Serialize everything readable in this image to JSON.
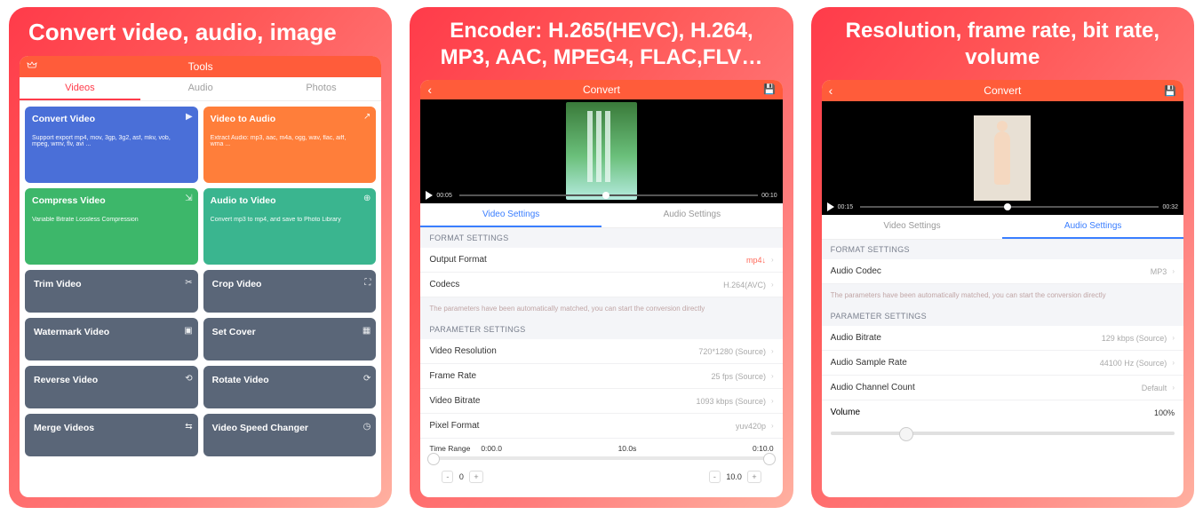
{
  "screen1": {
    "hero": "Convert video, audio, image",
    "topbar_title": "Tools",
    "tabs": [
      "Videos",
      "Audio",
      "Photos"
    ],
    "active_tab": 0,
    "cards": [
      {
        "title": "Convert Video",
        "desc": "Support export mp4, mov, 3gp, 3g2, asf, mkv, vob, mpeg, wmv, flv, avi ...",
        "icon": "play"
      },
      {
        "title": "Video to Audio",
        "desc": "Extract Audio: mp3, aac, m4a, ogg, wav, flac, aiff, wma ...",
        "icon": "export"
      },
      {
        "title": "Compress Video",
        "desc": "Variable Bitrate Lossless Compression",
        "icon": "compress"
      },
      {
        "title": "Audio to Video",
        "desc": "Convert mp3 to mp4, and save to Photo Library",
        "icon": "tovideo"
      },
      {
        "title": "Trim Video",
        "icon": "scissors"
      },
      {
        "title": "Crop Video",
        "icon": "crop"
      },
      {
        "title": "Watermark Video",
        "icon": "watermark"
      },
      {
        "title": "Set Cover",
        "icon": "cover"
      },
      {
        "title": "Reverse Video",
        "icon": "reverse"
      },
      {
        "title": "Rotate Video",
        "icon": "rotate"
      },
      {
        "title": "Merge Videos",
        "icon": "merge"
      },
      {
        "title": "Video Speed Changer",
        "icon": "speed"
      }
    ]
  },
  "screen2": {
    "hero": "Encoder: H.265(HEVC), H.264, MP3, AAC, MPEG4, FLAC,FLV…",
    "nav_title": "Convert",
    "time_left": "00:05",
    "time_right": "00:10",
    "tabs": [
      "Video Settings",
      "Audio Settings"
    ],
    "active_tab": 0,
    "format_header": "FORMAT SETTINGS",
    "rows_format": [
      {
        "label": "Output Format",
        "value": "mp4↓"
      },
      {
        "label": "Codecs",
        "value": "H.264(AVC)"
      }
    ],
    "hint": "The parameters have been automatically matched, you can start the conversion directly",
    "param_header": "PARAMETER SETTINGS",
    "rows_param": [
      {
        "label": "Video Resolution",
        "value": "720*1280 (Source)"
      },
      {
        "label": "Frame Rate",
        "value": "25 fps (Source)"
      },
      {
        "label": "Video Bitrate",
        "value": "1093 kbps (Source)"
      },
      {
        "label": "Pixel Format",
        "value": "yuv420p"
      }
    ],
    "time_range": {
      "label": "Time Range",
      "start": "0:00.0",
      "mid": "10.0s",
      "end": "0:10.0"
    },
    "inc": {
      "left_dec": "-",
      "left_val": "0",
      "left_inc": "+",
      "right_dec": "-",
      "right_val": "10.0",
      "right_inc": "+"
    }
  },
  "screen3": {
    "hero": "Resolution, frame rate, bit rate, volume",
    "nav_title": "Convert",
    "time_left": "00:15",
    "time_right": "00:32",
    "tabs": [
      "Video Settings",
      "Audio Settings"
    ],
    "active_tab": 1,
    "format_header": "FORMAT SETTINGS",
    "rows_format": [
      {
        "label": "Audio Codec",
        "value": "MP3"
      }
    ],
    "hint": "The parameters have been automatically matched, you can start the conversion directly",
    "param_header": "PARAMETER SETTINGS",
    "rows_param": [
      {
        "label": "Audio Bitrate",
        "value": "129 kbps (Source)"
      },
      {
        "label": "Audio Sample Rate",
        "value": "44100 Hz (Source)"
      },
      {
        "label": "Audio Channel Count",
        "value": "Default"
      }
    ],
    "volume": {
      "label": "Volume",
      "value": "100%"
    }
  }
}
